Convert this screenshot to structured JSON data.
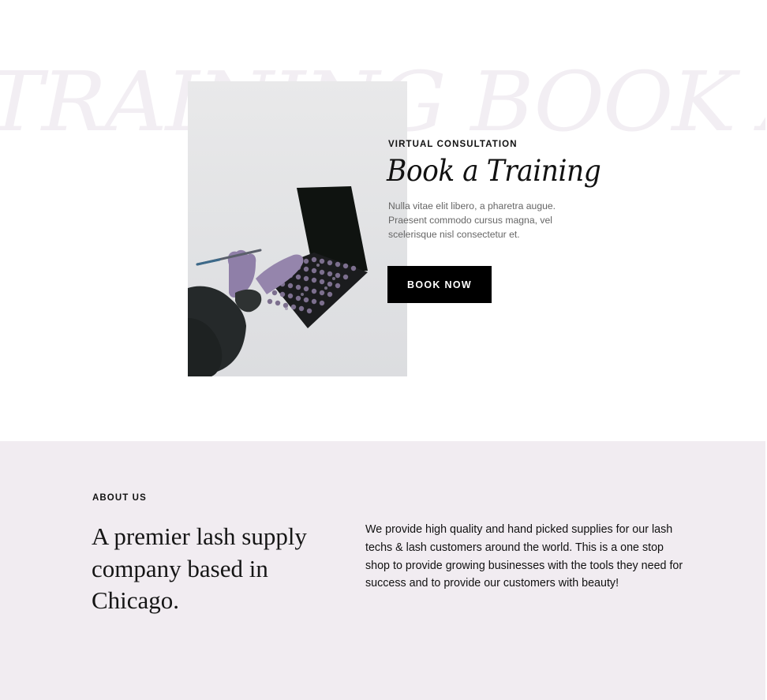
{
  "training": {
    "marquee_text": "TRAINING BOOK A TRAINING",
    "label": "VIRTUAL CONSULTATION",
    "title": "Book a Training",
    "description": "Nulla vitae elit libero, a pharetra augue. Praesent commodo cursus magna, vel scelerisque nisl consectetur et.",
    "button_label": "BOOK NOW",
    "accent_marquee_color": "#f2eef3",
    "button_color": "#000000"
  },
  "about": {
    "label": "ABOUT US",
    "heading": "A premier lash supply company based in Chicago.",
    "body": "We provide high quality and hand picked supplies for our lash techs & lash customers around the world. This is a one stop shop to provide growing businesses with the tools they need for success and to provide our customers with beauty!",
    "background_color": "#f1ecf1"
  },
  "icons": {
    "photo": "makeup-palette-photo"
  }
}
